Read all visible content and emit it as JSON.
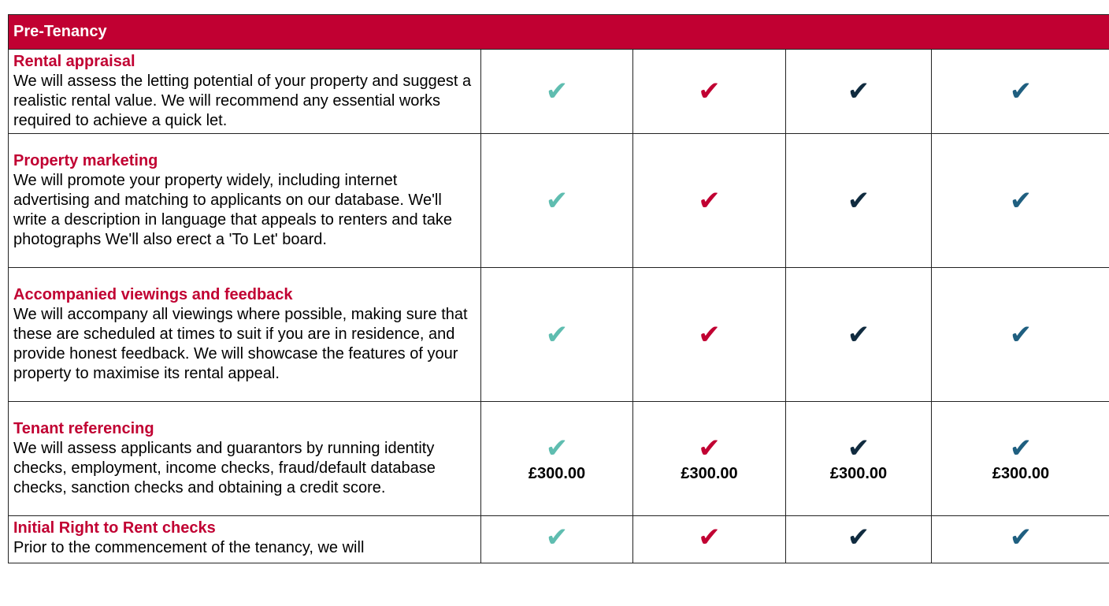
{
  "section_title": "Pre-Tenancy",
  "colors": {
    "header_bg": "#c10032",
    "title_text": "#c10032",
    "tier1": "#5fbdb0",
    "tier2": "#c10032",
    "tier3": "#102b3f",
    "tier4": "#1f5f80"
  },
  "check_glyph": "✔",
  "rows": [
    {
      "title": "Rental appraisal",
      "text": "We will assess the letting potential of your property and suggest a realistic rental value. We will recommend any essential works required to achieve a quick let.",
      "prices": [
        "",
        "",
        "",
        ""
      ]
    },
    {
      "title": "Property marketing",
      "text": "We will promote your property widely, including internet advertising and matching to applicants on our database. We'll write a description in language that appeals to renters and take photographs We'll also erect a 'To Let' board.",
      "prices": [
        "",
        "",
        "",
        ""
      ]
    },
    {
      "title": "Accompanied viewings and feedback",
      "text": "We will accompany all viewings where possible, making sure that these are scheduled at times to suit if you are in residence, and provide honest feedback. We will showcase the features of your property to maximise its rental appeal.",
      "prices": [
        "",
        "",
        "",
        ""
      ]
    },
    {
      "title": "Tenant referencing",
      "text": "We will assess applicants and guarantors by running identity checks, employment, income checks, fraud/default database checks, sanction checks and obtaining a credit score.",
      "prices": [
        "£300.00",
        "£300.00",
        "£300.00",
        "£300.00"
      ]
    },
    {
      "title": "Initial Right to Rent checks",
      "text": "Prior to the commencement of the tenancy, we will",
      "prices": [
        "",
        "",
        "",
        ""
      ]
    }
  ]
}
